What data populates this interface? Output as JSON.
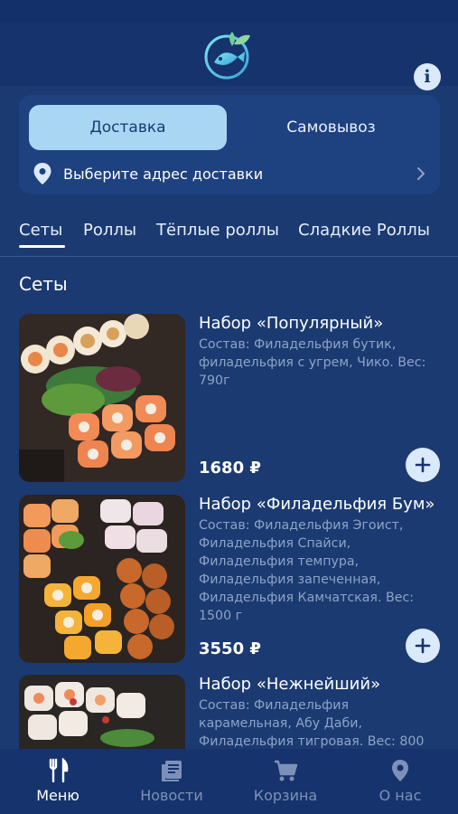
{
  "header": {
    "logo_icon": "fish-leaf-logo",
    "info_icon": "info-icon"
  },
  "delivery": {
    "delivery_label": "Доставка",
    "pickup_label": "Самовывоз",
    "address_placeholder": "Выберите адрес доставки",
    "pin_icon": "location-pin-icon",
    "chevron_icon": "chevron-right-icon"
  },
  "tabs": [
    {
      "label": "Сеты",
      "active": true
    },
    {
      "label": "Роллы"
    },
    {
      "label": "Тёплые роллы"
    },
    {
      "label": "Сладкие Роллы"
    }
  ],
  "section_title": "Сеты",
  "products": [
    {
      "title": "Набор «Популярный»",
      "description": "Состав: Филадельфия бутик, филадельфия с угрем, Чико. Вес: 790г",
      "price": "1680 ₽"
    },
    {
      "title": "Набор «Филадельфия Бум»",
      "description": "Состав: Филадельфия Эгоист, Филадельфия Спайси, Филадельфия темпура, Филадельфия запеченная, Филадельфия Камчатская. Вес: 1500 г",
      "price": "3550 ₽"
    },
    {
      "title": "Набор «Нежнейший»",
      "description": "Состав: Филадельфия карамельная, Абу Даби, Филадельфия тигровая. Вес: 800",
      "price": ""
    }
  ],
  "bottom_nav": [
    {
      "label": "Меню",
      "icon": "fork-knife-icon",
      "active": true
    },
    {
      "label": "Новости",
      "icon": "news-icon"
    },
    {
      "label": "Корзина",
      "icon": "cart-icon"
    },
    {
      "label": "О нас",
      "icon": "location-pin-icon"
    }
  ],
  "colors": {
    "background": "#1b3a72",
    "card": "#1e4180",
    "active_segment": "#a9d7f3",
    "muted_text": "#8ea3c6"
  }
}
